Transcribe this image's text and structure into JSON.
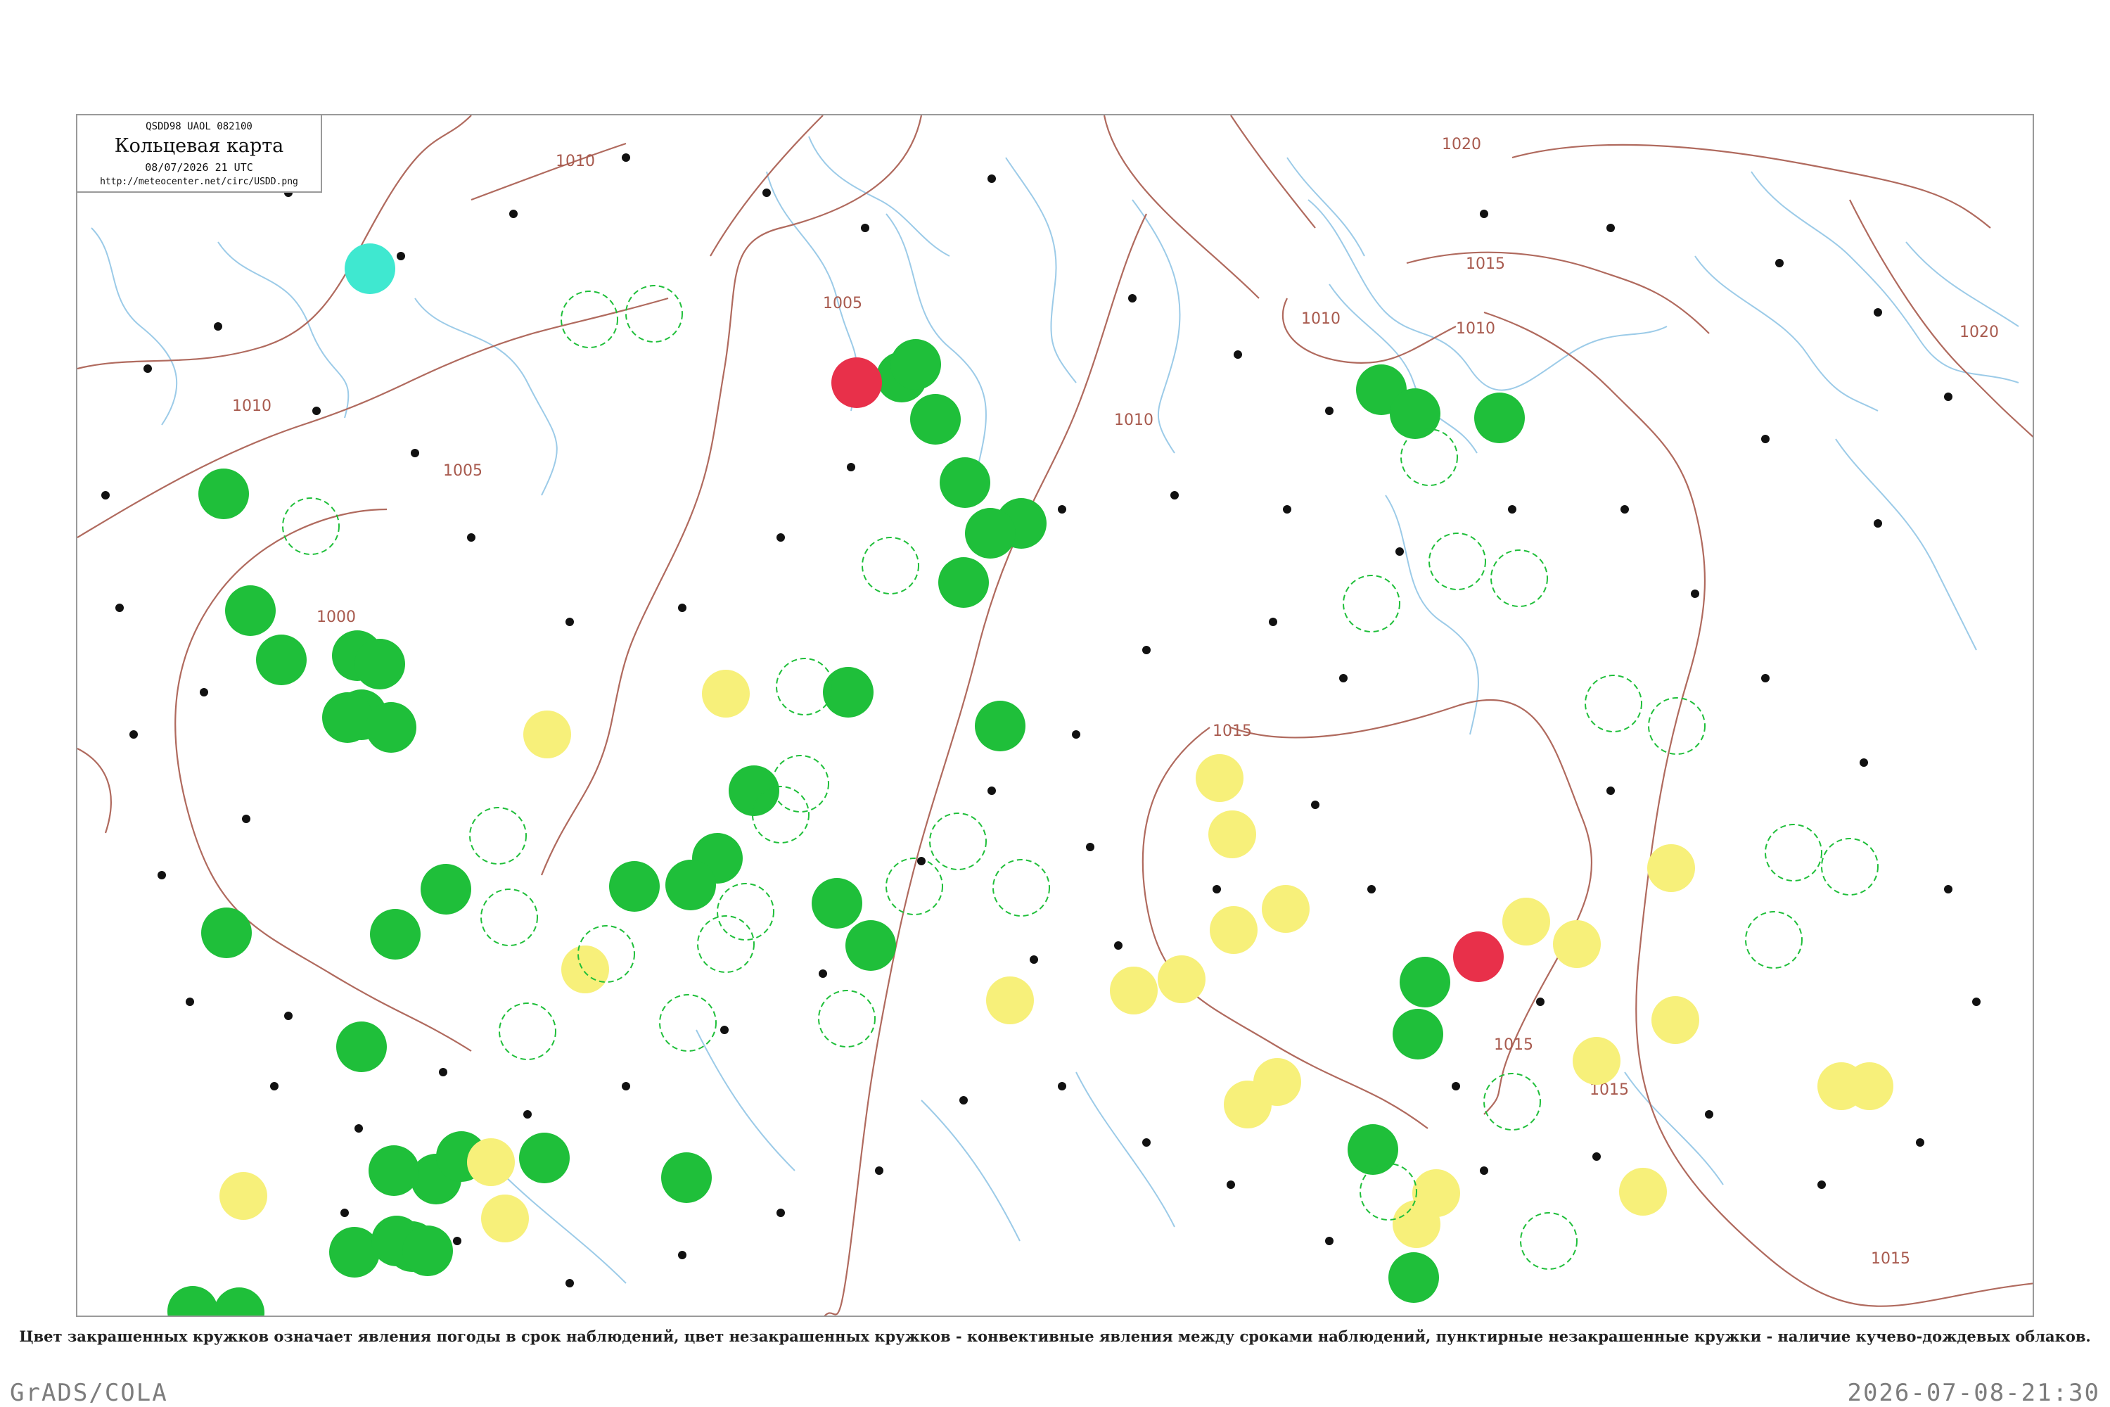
{
  "header": {
    "code": "QSDD98  UAOL  082100",
    "title": "Кольцевая карта",
    "datetime": "08/07/2026 21 UTC",
    "url": "http://meteocenter.net/circ/USDD.png"
  },
  "caption": "Цвет закрашенных кружков означает явления погоды в срок наблюдений, цвет незакрашенных кружков - конвективные явления между сроками наблюдений, пунктирные незакрашенные кружки - наличие кучево-дождевых облаков.",
  "footer": {
    "left": "GrADS/COLA",
    "right": "2026-07-08-21:30"
  },
  "colors": {
    "isobar": "#b06a5e",
    "river": "#9ccbe8",
    "frame": "#9a9a9a",
    "rain": "#1fbf3a",
    "thunder": "#e8304a",
    "fog": "#f7f07a",
    "shower_ring": "#1fbf3a",
    "snow": "#3fe8d0"
  },
  "isobars": [
    {
      "label": "1020"
    },
    {
      "label": "1020"
    },
    {
      "label": "1015"
    },
    {
      "label": "1015"
    },
    {
      "label": "1015"
    },
    {
      "label": "1015"
    },
    {
      "label": "1015"
    },
    {
      "label": "1010"
    },
    {
      "label": "1010"
    },
    {
      "label": "1010"
    },
    {
      "label": "1010"
    },
    {
      "label": "1010"
    },
    {
      "label": "1005"
    },
    {
      "label": "1005"
    },
    {
      "label": "1000"
    }
  ],
  "stations": {
    "rain_filled": [
      {
        "id": "s1"
      },
      {
        "id": "s2"
      },
      {
        "id": "s3"
      },
      {
        "id": "s4"
      },
      {
        "id": "s5"
      },
      {
        "id": "s6"
      },
      {
        "id": "s7"
      },
      {
        "id": "s8"
      },
      {
        "id": "s9"
      },
      {
        "id": "s10"
      },
      {
        "id": "s11"
      },
      {
        "id": "s12"
      },
      {
        "id": "s13"
      },
      {
        "id": "s14"
      },
      {
        "id": "s15"
      },
      {
        "id": "s16"
      },
      {
        "id": "s17"
      },
      {
        "id": "s18"
      },
      {
        "id": "s19"
      },
      {
        "id": "s20"
      },
      {
        "id": "s21"
      },
      {
        "id": "s22"
      },
      {
        "id": "s23"
      },
      {
        "id": "s24"
      },
      {
        "id": "s25"
      },
      {
        "id": "s26"
      },
      {
        "id": "s27"
      },
      {
        "id": "s28"
      },
      {
        "id": "s29"
      },
      {
        "id": "s30"
      },
      {
        "id": "s31"
      },
      {
        "id": "s32"
      },
      {
        "id": "s33"
      },
      {
        "id": "s34"
      },
      {
        "id": "s35"
      },
      {
        "id": "s36"
      },
      {
        "id": "s37"
      },
      {
        "id": "s38"
      },
      {
        "id": "s39"
      },
      {
        "id": "s40"
      },
      {
        "id": "s41"
      },
      {
        "id": "s42"
      },
      {
        "id": "s43"
      }
    ],
    "thunder_filled": [
      {
        "id": "t1"
      },
      {
        "id": "t2"
      }
    ],
    "snow_filled": [
      {
        "id": "c1"
      }
    ],
    "fog_filled": [
      {
        "id": "f1"
      },
      {
        "id": "f2"
      },
      {
        "id": "f3"
      },
      {
        "id": "f4"
      },
      {
        "id": "f5"
      },
      {
        "id": "f6"
      },
      {
        "id": "f7"
      },
      {
        "id": "f8"
      },
      {
        "id": "f9"
      },
      {
        "id": "f10"
      },
      {
        "id": "f11"
      },
      {
        "id": "f12"
      },
      {
        "id": "f13"
      },
      {
        "id": "f14"
      },
      {
        "id": "f15"
      },
      {
        "id": "f16"
      },
      {
        "id": "f17"
      },
      {
        "id": "f18"
      },
      {
        "id": "f19"
      },
      {
        "id": "f20"
      },
      {
        "id": "f21"
      },
      {
        "id": "f22"
      },
      {
        "id": "f23"
      },
      {
        "id": "f24"
      },
      {
        "id": "f25"
      }
    ],
    "dashed_rings": [
      {
        "id": "d1"
      },
      {
        "id": "d2"
      },
      {
        "id": "d3"
      },
      {
        "id": "d4"
      },
      {
        "id": "d5"
      },
      {
        "id": "d6"
      },
      {
        "id": "d7"
      },
      {
        "id": "d8"
      },
      {
        "id": "d9"
      },
      {
        "id": "d10"
      },
      {
        "id": "d11"
      },
      {
        "id": "d12"
      },
      {
        "id": "d13"
      },
      {
        "id": "d14"
      },
      {
        "id": "d15"
      },
      {
        "id": "d16"
      },
      {
        "id": "d17"
      },
      {
        "id": "d18"
      },
      {
        "id": "d19"
      },
      {
        "id": "d20"
      },
      {
        "id": "d21"
      },
      {
        "id": "d22"
      },
      {
        "id": "d23"
      },
      {
        "id": "d24"
      },
      {
        "id": "d25"
      },
      {
        "id": "d26"
      },
      {
        "id": "d27"
      },
      {
        "id": "d28"
      },
      {
        "id": "d29"
      },
      {
        "id": "d30"
      }
    ]
  }
}
